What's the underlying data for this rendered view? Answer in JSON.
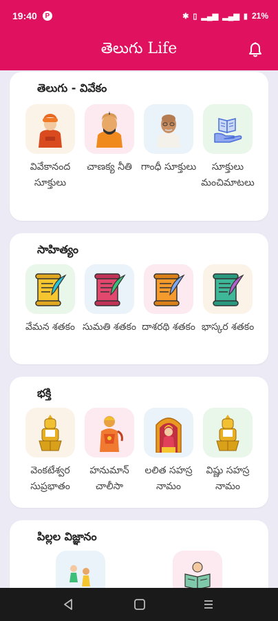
{
  "status_bar": {
    "time": "19:40",
    "battery": "21%"
  },
  "app_bar": {
    "title": "తెలుగు Life"
  },
  "sections": [
    {
      "title": "తెలుగు - వివేకం",
      "items": [
        {
          "label": "వివేకానంద సూక్తులు",
          "icon": "vivekananda-icon"
        },
        {
          "label": "చాణక్య నీతి",
          "icon": "chanakya-icon"
        },
        {
          "label": "గాంధీ సూక్తులు",
          "icon": "gandhi-icon"
        },
        {
          "label": "సూక్తులు మంచిమాటలు",
          "icon": "book-hand-icon"
        }
      ]
    },
    {
      "title": "సాహిత్యం",
      "items": [
        {
          "label": "వేమన శతకం",
          "icon": "scroll-quill-icon"
        },
        {
          "label": "సుమతి శతకం",
          "icon": "scroll-quill-icon"
        },
        {
          "label": "దాశరథి శతకం",
          "icon": "scroll-quill-icon"
        },
        {
          "label": "భాస్కర శతకం",
          "icon": "scroll-quill-icon"
        }
      ]
    },
    {
      "title": "భక్తి",
      "items": [
        {
          "label": "వెంకటేశ్వర సుప్రభాతం",
          "icon": "venkateswara-icon"
        },
        {
          "label": "హనుమాన్ చాలీసా",
          "icon": "hanuman-icon"
        },
        {
          "label": "లలిత సహస్రనామం",
          "icon": "lalitha-icon"
        },
        {
          "label": "విష్ణు సహస్రనామం",
          "icon": "vishnu-icon"
        }
      ]
    },
    {
      "title": "పిల్లల విజ్ఞానం",
      "items": [
        {
          "label": "",
          "icon": "kids-icon"
        },
        {
          "label": "",
          "icon": "reading-icon"
        }
      ]
    }
  ],
  "colors": {
    "primary": "#E0115F",
    "background": "#ECEAF4"
  }
}
